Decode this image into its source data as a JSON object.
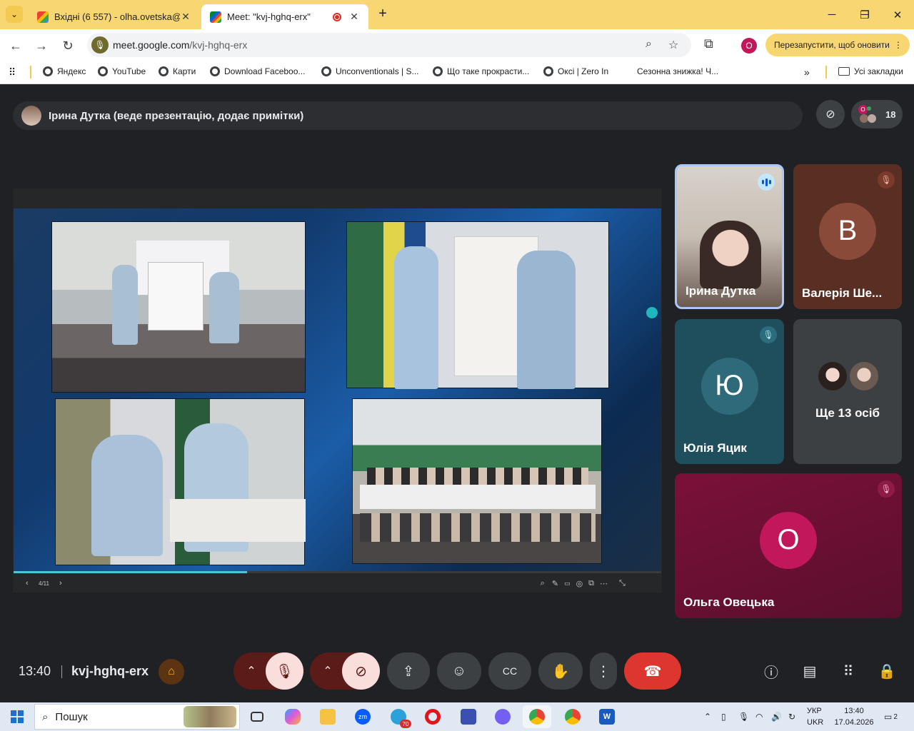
{
  "browser": {
    "tabs": [
      {
        "title": "Вхідні (6 557) - olha.ovetska@n",
        "favicon": "gmail-icon",
        "active": false
      },
      {
        "title": "Meet: \"kvj-hghq-erx\"",
        "favicon": "google-meet-icon",
        "active": true
      }
    ],
    "new_tab": "+",
    "window": {
      "minimize": "─",
      "restore": "❐",
      "close": "✕"
    },
    "url_host": "meet.google.com",
    "url_path": "/kvj-hghq-erx",
    "profile_initial": "O",
    "relaunch_label": "Перезапустити, щоб оновити",
    "bookmarks": [
      "Яндекс",
      "YouTube",
      "Карти",
      "Download Faceboo...",
      "Unconventionals | S...",
      "Що таке прокрасти...",
      "Оксі | Zero In",
      "Сезонна знижка! Ч..."
    ],
    "all_bookmarks": "Усі закладки",
    "colors": {
      "tab_strip": "#f8d772",
      "profile": "#c2185b"
    }
  },
  "meet": {
    "presenter_label": "Ірина Дутка (веде презентацію, додає примітки)",
    "participant_count": "18",
    "people_avatar_initial": "O",
    "slide": {
      "page": "4/11",
      "progress_fraction": 0.36
    },
    "tiles": [
      {
        "name": "Ірина Дутка",
        "type": "video",
        "speaking": true
      },
      {
        "name": "Валерія Ше...",
        "initial": "В",
        "muted": true
      },
      {
        "name": "Юлія Яцик",
        "initial": "Ю",
        "muted": true
      },
      {
        "name": "Ще 13 осіб",
        "type": "more"
      },
      {
        "name": "Ольга Овецька",
        "initial": "О",
        "muted": true
      }
    ],
    "clock": "13:40",
    "meeting_code": "kvj-hghq-erx",
    "colors": {
      "background": "#202124",
      "end_call": "#dc362e",
      "muted_ctrl": "#f9dedc"
    }
  },
  "taskbar": {
    "search_placeholder": "Пошук",
    "telegram_badge": "70",
    "language": "УКР",
    "language_sub": "UKR",
    "time": "13:40",
    "date": "17.04.2026",
    "notifications": "2"
  }
}
